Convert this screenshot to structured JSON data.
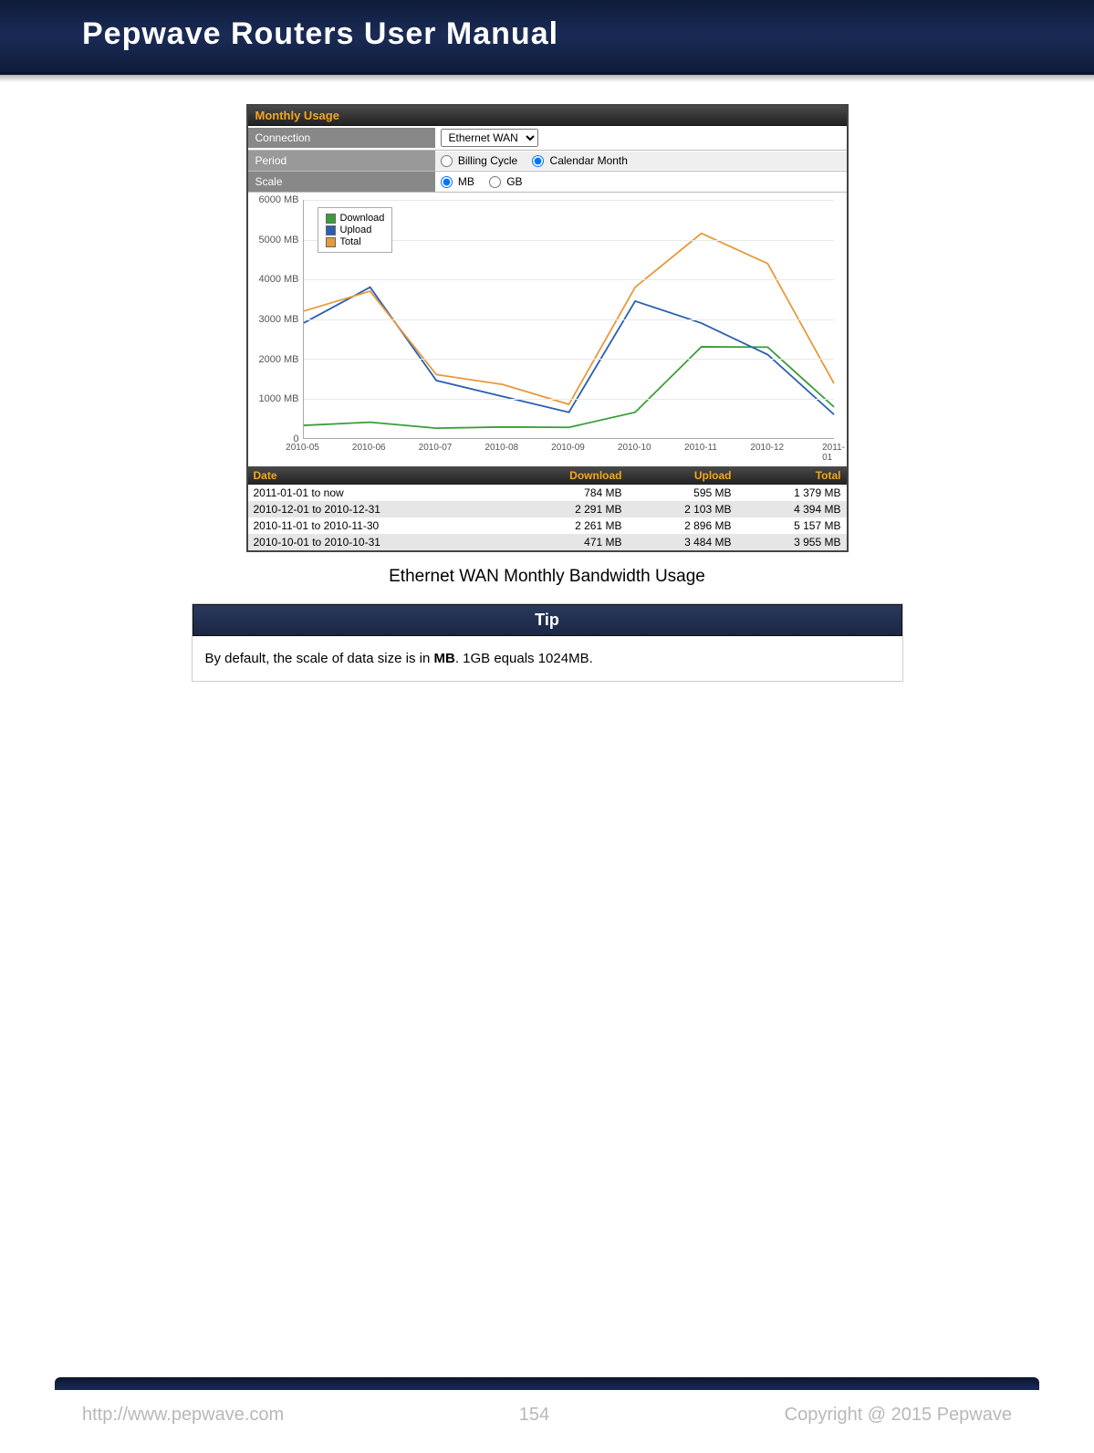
{
  "header": {
    "title": "Pepwave Routers User Manual"
  },
  "panel": {
    "title": "Monthly Usage",
    "connection": {
      "label": "Connection",
      "value": "Ethernet WAN"
    },
    "period": {
      "label": "Period",
      "opt1": "Billing Cycle",
      "opt2": "Calendar Month",
      "selected": "Calendar Month"
    },
    "scale": {
      "label": "Scale",
      "opt1": "MB",
      "opt2": "GB",
      "selected": "MB"
    }
  },
  "chart_data": {
    "type": "line",
    "title": "",
    "xlabel": "",
    "ylabel": "",
    "ylim": [
      0,
      6000
    ],
    "y_ticks": [
      "0",
      "1000 MB",
      "2000 MB",
      "3000 MB",
      "4000 MB",
      "5000 MB",
      "6000 MB"
    ],
    "categories": [
      "2010-05",
      "2010-06",
      "2010-07",
      "2010-08",
      "2010-09",
      "2010-10",
      "2010-11",
      "2010-12",
      "2011-01"
    ],
    "series": [
      {
        "name": "Download",
        "color": "#3a9d3a",
        "values": [
          320,
          400,
          250,
          280,
          270,
          650,
          2300,
          2291,
          784
        ]
      },
      {
        "name": "Upload",
        "color": "#2a5fb0",
        "values": [
          2900,
          3800,
          1450,
          1050,
          650,
          3450,
          2896,
          2103,
          595
        ]
      },
      {
        "name": "Total",
        "color": "#e59a3a",
        "values": [
          3200,
          3700,
          1600,
          1350,
          850,
          3800,
          5157,
          4394,
          1379
        ]
      }
    ],
    "legend_labels": {
      "download": "Download",
      "upload": "Upload",
      "total": "Total"
    }
  },
  "table": {
    "headers": {
      "date": "Date",
      "download": "Download",
      "upload": "Upload",
      "total": "Total"
    },
    "rows": [
      {
        "date": "2011-01-01 to now",
        "download": "784 MB",
        "upload": "595 MB",
        "total": "1 379 MB"
      },
      {
        "date": "2010-12-01 to 2010-12-31",
        "download": "2 291 MB",
        "upload": "2 103 MB",
        "total": "4 394 MB"
      },
      {
        "date": "2010-11-01 to 2010-11-30",
        "download": "2 261 MB",
        "upload": "2 896 MB",
        "total": "5 157 MB"
      },
      {
        "date": "2010-10-01 to 2010-10-31",
        "download": "471 MB",
        "upload": "3 484 MB",
        "total": "3 955 MB"
      }
    ]
  },
  "caption": "Ethernet WAN Monthly Bandwidth Usage",
  "tip": {
    "title": "Tip",
    "body_pre": "By default, the scale of data size is in ",
    "body_bold": "MB",
    "body_post": ". 1GB equals 1024MB."
  },
  "footer": {
    "url": "http://www.pepwave.com",
    "page": "154",
    "copyright": "Copyright @ 2015 Pepwave"
  }
}
